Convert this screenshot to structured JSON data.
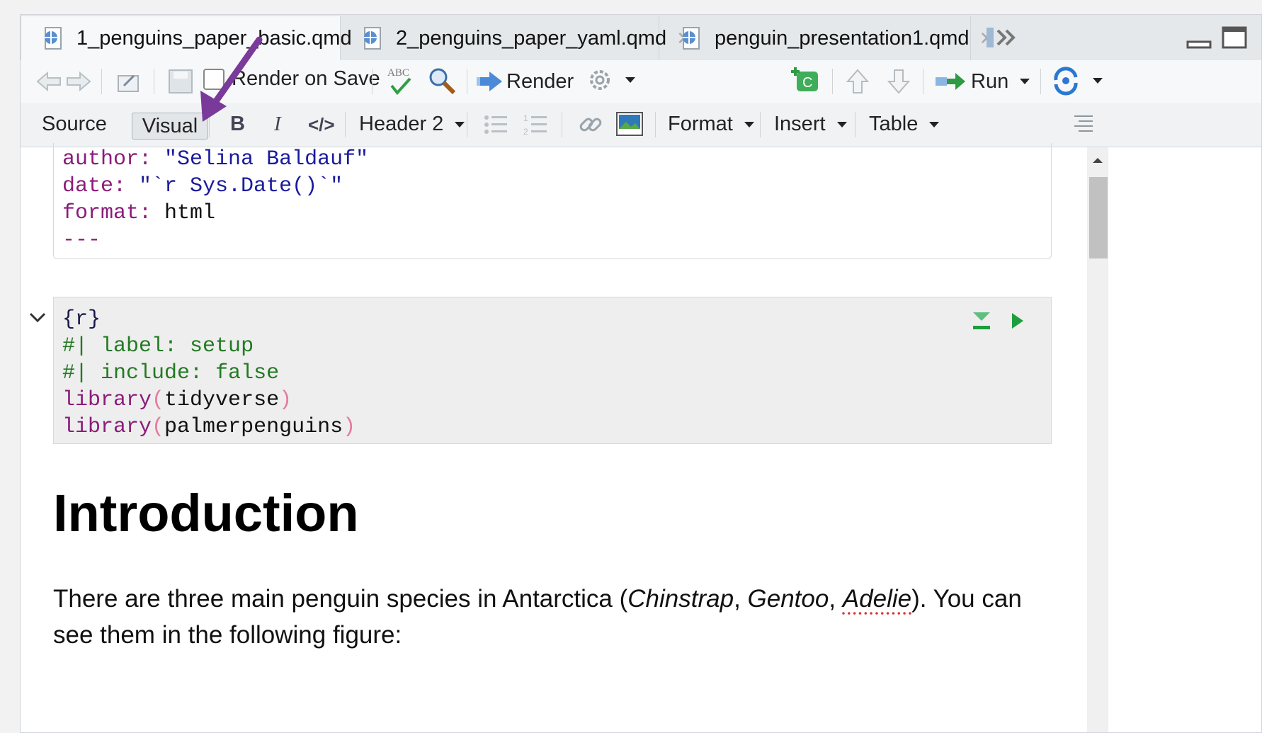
{
  "tabs": [
    {
      "label": "1_penguins_paper_basic.qmd",
      "active": true
    },
    {
      "label": "2_penguins_paper_yaml.qmd",
      "active": false
    },
    {
      "label": "penguin_presentation1.qmd",
      "active": false
    }
  ],
  "toolbar": {
    "render_on_save": "Render on Save",
    "render_label": "Render",
    "run_label": "Run"
  },
  "format_bar": {
    "source": "Source",
    "visual": "Visual",
    "header_select": "Header 2",
    "format_menu": "Format",
    "insert_menu": "Insert",
    "table_menu": "Table"
  },
  "yaml": {
    "author_key": "author:",
    "author_value": "\"Selina Baldauf\"",
    "date_key": "date:",
    "date_value": "\"`r Sys.Date()`\"",
    "format_key": "format:",
    "format_value": "html",
    "end": "---"
  },
  "chunk": {
    "header": "{r}",
    "opt1_prefix": "#|",
    "opt1": "label: setup",
    "opt2_prefix": "#|",
    "opt2": "include: false",
    "lib_fn": "library",
    "lib1": "tidyverse",
    "lib2": "palmerpenguins"
  },
  "document": {
    "heading": "Introduction",
    "para_before": "There are three main penguin species in Antarctica (",
    "species1": "Chinstrap",
    "sep1": ", ",
    "species2": "Gentoo",
    "sep2": ", ",
    "species3": "Adelie",
    "para_after": "). You can see them in the following figure:"
  },
  "colors": {
    "annotation_arrow": "#7a3a9a",
    "run_chunk": "#1e9e3e"
  }
}
